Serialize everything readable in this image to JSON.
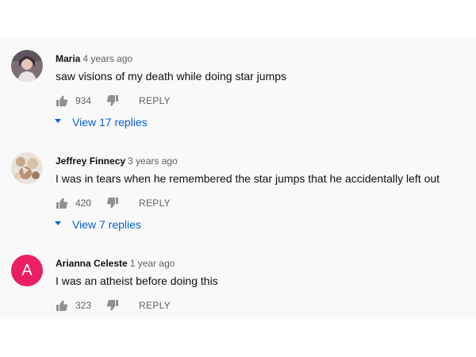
{
  "comments": [
    {
      "author": "Maria",
      "time": "4 years ago",
      "text": "saw visions of my death while doing star jumps",
      "likes": "934",
      "reply_label": "REPLY",
      "view_replies": "View 17 replies",
      "avatar_type": "photo"
    },
    {
      "author": "Jeffrey Finnecy",
      "time": "3 years ago",
      "text": "I was in tears when he remembered the star jumps that he accidentally left out",
      "likes": "420",
      "reply_label": "REPLY",
      "view_replies": "View 7 replies",
      "avatar_type": "photo"
    },
    {
      "author": "Arianna Celeste",
      "time": "1 year ago",
      "text": "I was an atheist before doing this",
      "likes": "323",
      "reply_label": "REPLY",
      "avatar_type": "letter",
      "avatar_letter": "A",
      "avatar_color": "#e91e63"
    }
  ],
  "colors": {
    "link": "#065fd4",
    "muted": "#606060",
    "background": "#f9f9f9"
  }
}
